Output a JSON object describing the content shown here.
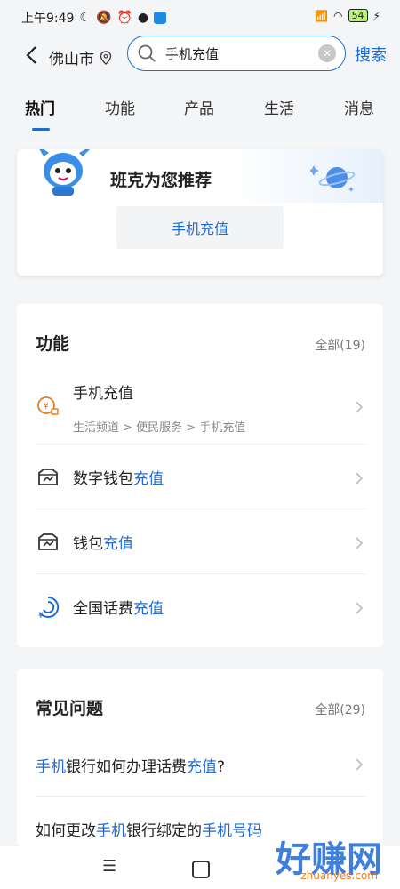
{
  "status": {
    "time": "上午9:49",
    "battery": "54"
  },
  "header": {
    "city": "佛山市",
    "search_value": "手机充值",
    "search_button": "搜索"
  },
  "tabs": [
    "热门",
    "功能",
    "产品",
    "生活",
    "消息"
  ],
  "recommend": {
    "title": "班克为您推荐",
    "chip": "手机充值"
  },
  "functions": {
    "title": "功能",
    "more": "全部(19)",
    "items": [
      {
        "prefix": "",
        "hl": "手机充值",
        "suffix": "",
        "path": "生活频道 > 便民服务 > 手机充值",
        "icon": "yen-tag-icon"
      },
      {
        "prefix": "数字钱包",
        "hl": "充值",
        "suffix": "",
        "icon": "wallet-icon"
      },
      {
        "prefix": "钱包",
        "hl": "充值",
        "suffix": "",
        "icon": "wallet-icon"
      },
      {
        "prefix": "全国话费",
        "hl": "充值",
        "suffix": "",
        "icon": "phone-bill-icon"
      }
    ]
  },
  "faq": {
    "title": "常见问题",
    "more": "全部(29)",
    "items": [
      {
        "a": "手机",
        "b": "银行如何办理话费",
        "c": "充值",
        "d": "?"
      },
      {
        "a": "如何更改",
        "b": "手机",
        "c": "银行绑定的",
        "d": "手机号码"
      }
    ]
  },
  "watermark": {
    "text": "好赚网",
    "sub": "zhuanyes.com"
  }
}
